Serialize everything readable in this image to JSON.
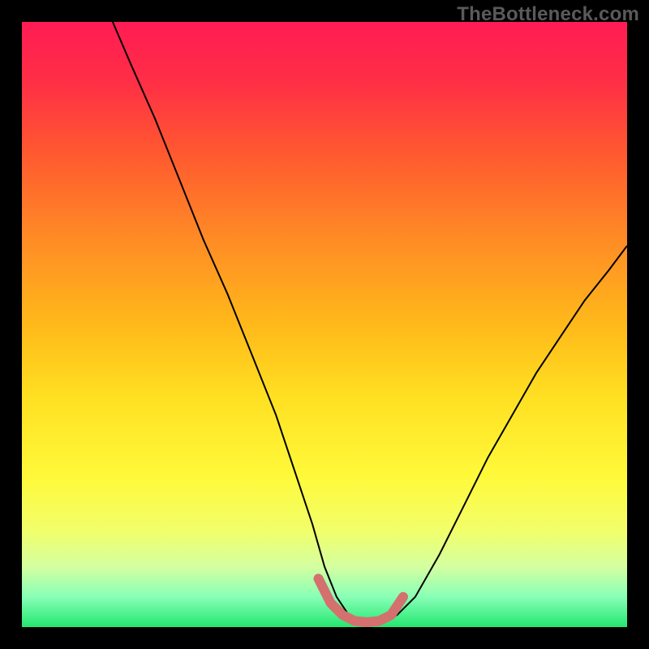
{
  "watermark": "TheBottleneck.com",
  "gradient": {
    "stops": [
      {
        "offset": 0.0,
        "color": "#ff1c54"
      },
      {
        "offset": 0.1,
        "color": "#ff2f46"
      },
      {
        "offset": 0.22,
        "color": "#ff5a2f"
      },
      {
        "offset": 0.35,
        "color": "#ff8826"
      },
      {
        "offset": 0.5,
        "color": "#ffb91a"
      },
      {
        "offset": 0.62,
        "color": "#ffe022"
      },
      {
        "offset": 0.75,
        "color": "#fff93a"
      },
      {
        "offset": 0.84,
        "color": "#f2ff6a"
      },
      {
        "offset": 0.9,
        "color": "#d4ffa0"
      },
      {
        "offset": 0.95,
        "color": "#88ffb6"
      },
      {
        "offset": 1.0,
        "color": "#23e770"
      }
    ]
  },
  "chart_data": {
    "type": "line",
    "title": "",
    "xlabel": "",
    "ylabel": "",
    "xlim": [
      0,
      100
    ],
    "ylim": [
      0,
      100
    ],
    "series": [
      {
        "name": "curve",
        "color": "#000000",
        "x": [
          15,
          18,
          22,
          26,
          30,
          34,
          38,
          42,
          45,
          48,
          50,
          52,
          54,
          56,
          58,
          60,
          62,
          65,
          69,
          73,
          77,
          81,
          85,
          89,
          93,
          97,
          100
        ],
        "y": [
          100,
          93,
          84,
          74,
          64,
          55,
          45,
          35,
          26,
          17,
          10,
          5,
          2,
          1,
          0.8,
          1,
          2,
          5,
          12,
          20,
          28,
          35,
          42,
          48,
          54,
          59,
          63
        ]
      },
      {
        "name": "highlight",
        "color": "#d4706e",
        "x": [
          49,
          51,
          53,
          55,
          57,
          59,
          61,
          63
        ],
        "y": [
          8,
          4,
          2,
          1,
          0.8,
          1,
          2,
          5
        ]
      }
    ]
  }
}
